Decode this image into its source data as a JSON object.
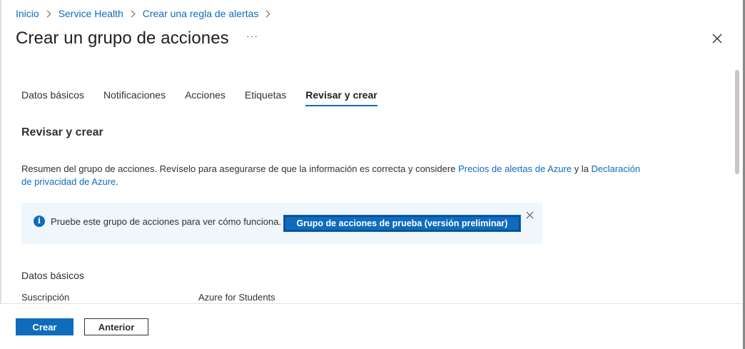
{
  "breadcrumb": {
    "items": [
      "Inicio",
      "Service Health",
      "Crear una regla de alertas"
    ]
  },
  "header": {
    "title": "Crear un grupo de acciones",
    "more_label": "···"
  },
  "tabs": [
    {
      "label": "Datos básicos",
      "active": false
    },
    {
      "label": "Notificaciones",
      "active": false
    },
    {
      "label": "Acciones",
      "active": false
    },
    {
      "label": "Etiquetas",
      "active": false
    },
    {
      "label": "Revisar y crear",
      "active": true
    }
  ],
  "review": {
    "section_title": "Revisar y crear",
    "summary_text": "Resumen del grupo de acciones. Revíselo para asegurarse de que la información es correcta y considere",
    "link_pricing": "Precios de alertas de Azure",
    "connector": "y la",
    "link_privacy": "Declaración de privacidad de Azure",
    "summary_end": "."
  },
  "info_box": {
    "text": "Pruebe este grupo de acciones para ver cómo funciona.",
    "button_label": "Grupo de acciones de prueba (versión preliminar)"
  },
  "basics": {
    "heading": "Datos básicos",
    "subscription_label": "Suscripción",
    "subscription_value": "Azure for Students"
  },
  "footer": {
    "create_label": "Crear",
    "previous_label": "Anterior"
  },
  "colors": {
    "accent": "#0f6cbd",
    "info_background": "#eff6fc",
    "text": "#323130"
  }
}
